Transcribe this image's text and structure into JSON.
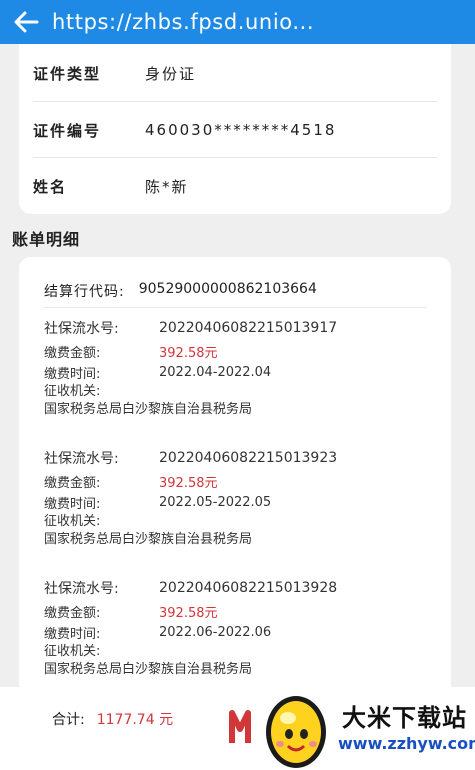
{
  "header": {
    "url": "https://zhbs.fpsd.unio..."
  },
  "identity": [
    {
      "label": "证件类型",
      "value": "身份证"
    },
    {
      "label": "证件编号",
      "value": "460030********4518"
    },
    {
      "label": "姓名",
      "value": "陈*新"
    }
  ],
  "section_title": "账单明细",
  "detail": {
    "code_label": "结算行代码:",
    "code_value": "90529000000862103664",
    "records": [
      {
        "serial_label": "社保流水号:",
        "serial": "20220406082215013917",
        "amount_label": "缴费金额:",
        "amount": "392.58元",
        "time_label": "缴费时间:",
        "time": "2022.04-2022.04",
        "org_label": "征收机关:",
        "org": "国家税务总局白沙黎族自治县税务局"
      },
      {
        "serial_label": "社保流水号:",
        "serial": "20220406082215013923",
        "amount_label": "缴费金额:",
        "amount": "392.58元",
        "time_label": "缴费时间:",
        "time": "2022.05-2022.05",
        "org_label": "征收机关:",
        "org": "国家税务总局白沙黎族自治县税务局"
      },
      {
        "serial_label": "社保流水号:",
        "serial": "20220406082215013928",
        "amount_label": "缴费金额:",
        "amount": "392.58元",
        "time_label": "缴费时间:",
        "time": "2022.06-2022.06",
        "org_label": "征收机关:",
        "org": "国家税务总局白沙黎族自治县税务局"
      }
    ]
  },
  "footer": {
    "total_label": "合计:",
    "total_value": "1177.74 元"
  },
  "watermark": {
    "title": "大米下载站",
    "url": "www.zzhyw.com"
  },
  "colors": {
    "header_bg": "#1e8ae6",
    "amount": "#d0363a",
    "watermark_url": "#1a4fc2"
  }
}
